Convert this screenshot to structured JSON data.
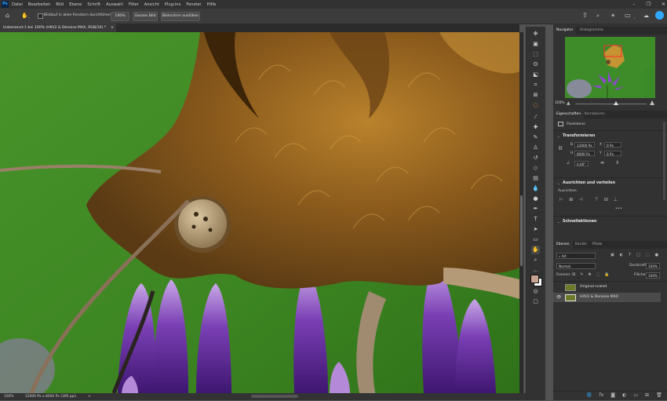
{
  "menubar": {
    "app_logo": "Ps",
    "items": [
      "Datei",
      "Bearbeiten",
      "Bild",
      "Ebene",
      "Schrift",
      "Auswahl",
      "Filter",
      "Ansicht",
      "Plug-ins",
      "Fenster",
      "Hilfe"
    ]
  },
  "options": {
    "scroll_all_label": "Bildlauf in allen Fenstern durchführen",
    "zoom_100": "100%",
    "fit_screen": "Ganzes Bild",
    "fill_screen": "Bildschirm ausfüllen"
  },
  "document": {
    "tab_title": "Unbenannt-1 bei 100% (HIIV2 & Denoise MAX, RGB/16) *",
    "tab_close": "×"
  },
  "status": {
    "zoom": "100%",
    "doc_info": "12000 Px x 8000 Px (300 ppi)",
    "arrow": ">"
  },
  "navigator": {
    "tabs": [
      "Navigator",
      "Histogramme"
    ],
    "zoom": "100%"
  },
  "properties": {
    "tabs": [
      "Eigenschaften",
      "Korrekturen"
    ],
    "layer_type": "Pixelebene",
    "transform": {
      "heading": "Transformieren",
      "w_label": "B",
      "w_value": "12000 Px",
      "h_label": "H",
      "h_value": "8000 Px",
      "x_label": "X",
      "x_value": "0 Px",
      "y_label": "Y",
      "y_value": "0 Px",
      "angle_value": "0,00°"
    },
    "align": {
      "heading": "Ausrichten und verteilen",
      "sub": "Ausrichten:"
    },
    "quick": {
      "heading": "Schnellaktionen"
    }
  },
  "layers": {
    "tabs": [
      "Ebenen",
      "Kanäle",
      "Pfade"
    ],
    "filter_kind": "Art",
    "blend_mode": "Normal",
    "opacity_label": "Deckkraft:",
    "opacity_value": "100%",
    "lock_label": "Fixieren:",
    "fill_label": "Fläche:",
    "fill_value": "100%",
    "items": [
      {
        "name": "Original scaled",
        "visible": false,
        "selected": false
      },
      {
        "name": "HIIV2 & Denoise MAX",
        "visible": true,
        "selected": true
      }
    ]
  },
  "colors": {
    "accent": "#31a8ff",
    "foreground": "#c8a390",
    "background": "#ffffff",
    "canvas_green": "#3f8a23"
  }
}
